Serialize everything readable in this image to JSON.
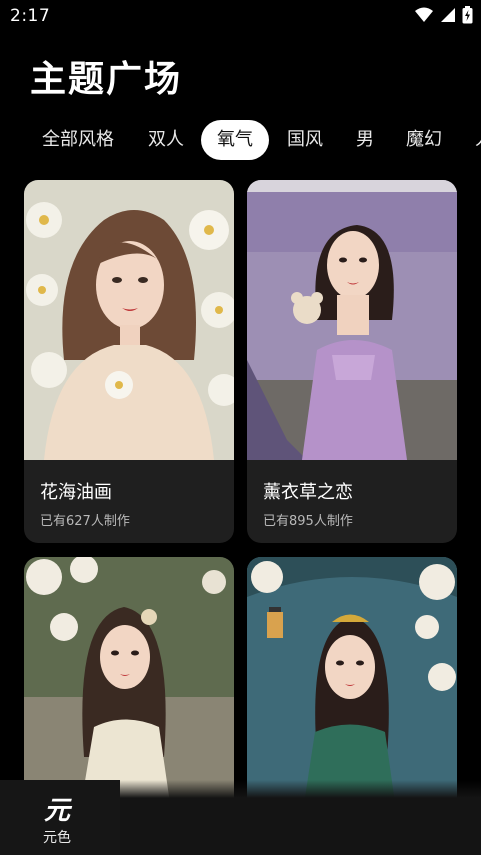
{
  "status_bar": {
    "time": "2:17"
  },
  "page": {
    "title": "主题广场"
  },
  "tabs": [
    {
      "label": "全部风格",
      "active": false
    },
    {
      "label": "双人",
      "active": false
    },
    {
      "label": "氧气",
      "active": true
    },
    {
      "label": "国风",
      "active": false
    },
    {
      "label": "男",
      "active": false
    },
    {
      "label": "魔幻",
      "active": false
    },
    {
      "label": "人",
      "active": false
    }
  ],
  "cards": [
    {
      "title": "花海油画",
      "count": "已有627人制作",
      "image": "woman-white-flowers-oil-painting"
    },
    {
      "title": "薰衣草之恋",
      "count": "已有895人制作",
      "image": "woman-lavender-field-purple-dress"
    },
    {
      "title": "",
      "count": "",
      "image": "woman-garden-white-blossoms"
    },
    {
      "title": "",
      "count": "",
      "image": "woman-teal-dress-lantern-blossoms"
    }
  ],
  "bottom_nav": {
    "logo": "元",
    "label": "元色"
  },
  "colors": {
    "background": "#000000",
    "card": "#1f1f1f",
    "active_tab": "#ffffff"
  }
}
